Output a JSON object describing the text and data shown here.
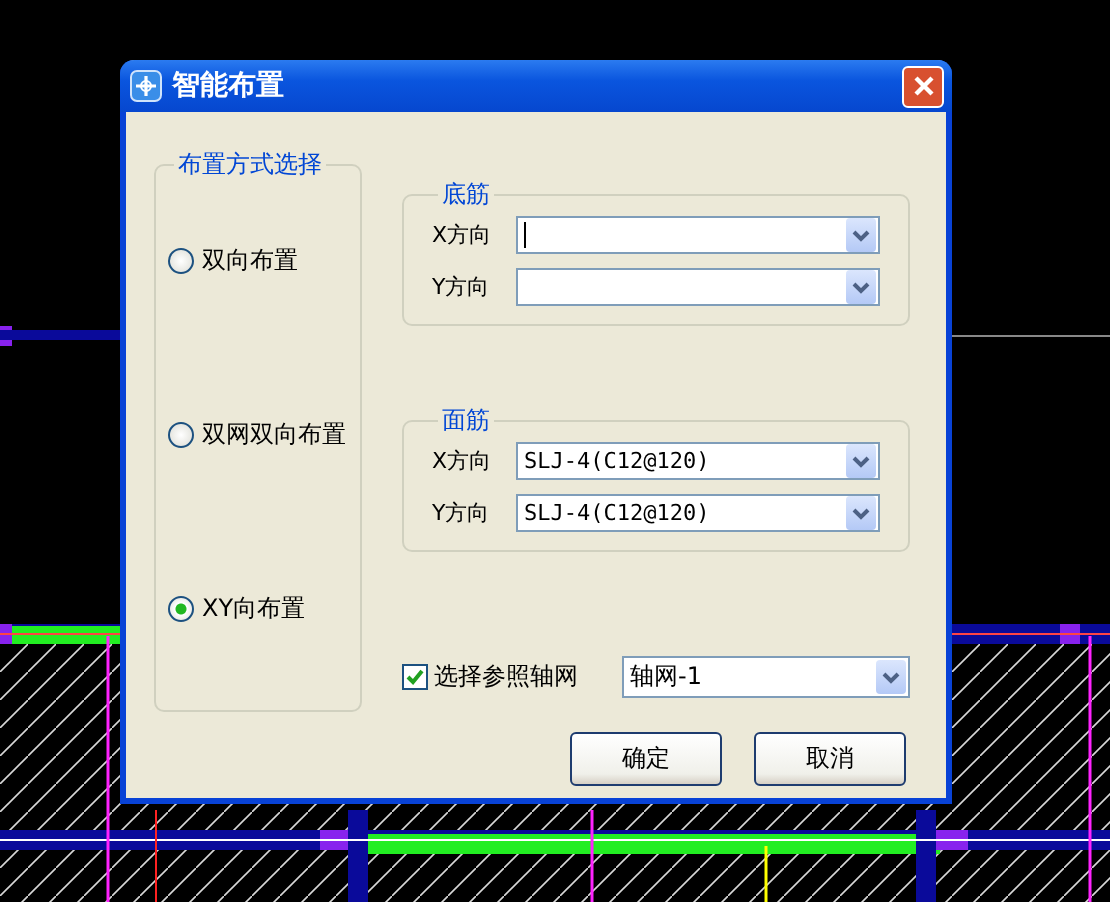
{
  "window": {
    "title": "智能布置"
  },
  "layout_group": {
    "title": "布置方式选择",
    "options": [
      {
        "label": "双向布置",
        "selected": false
      },
      {
        "label": "双网双向布置",
        "selected": false
      },
      {
        "label": "XY向布置",
        "selected": true
      }
    ]
  },
  "rebar_groups": [
    {
      "title": "底筋",
      "fields": [
        {
          "label": "X方向",
          "focused": true
        },
        {
          "label": "Y方向",
          "focused": false
        }
      ]
    },
    {
      "title": "面筋",
      "fields": [
        {
          "label": "X方向",
          "value": "SLJ-4(C12@120)",
          "focused": false
        },
        {
          "label": "Y方向",
          "value": "SLJ-4(C12@120)",
          "focused": false
        }
      ]
    }
  ],
  "reference_grid": {
    "label": "选择参照轴网",
    "checked": true,
    "value": "轴网-1"
  },
  "buttons": [
    "确定",
    "取消"
  ]
}
